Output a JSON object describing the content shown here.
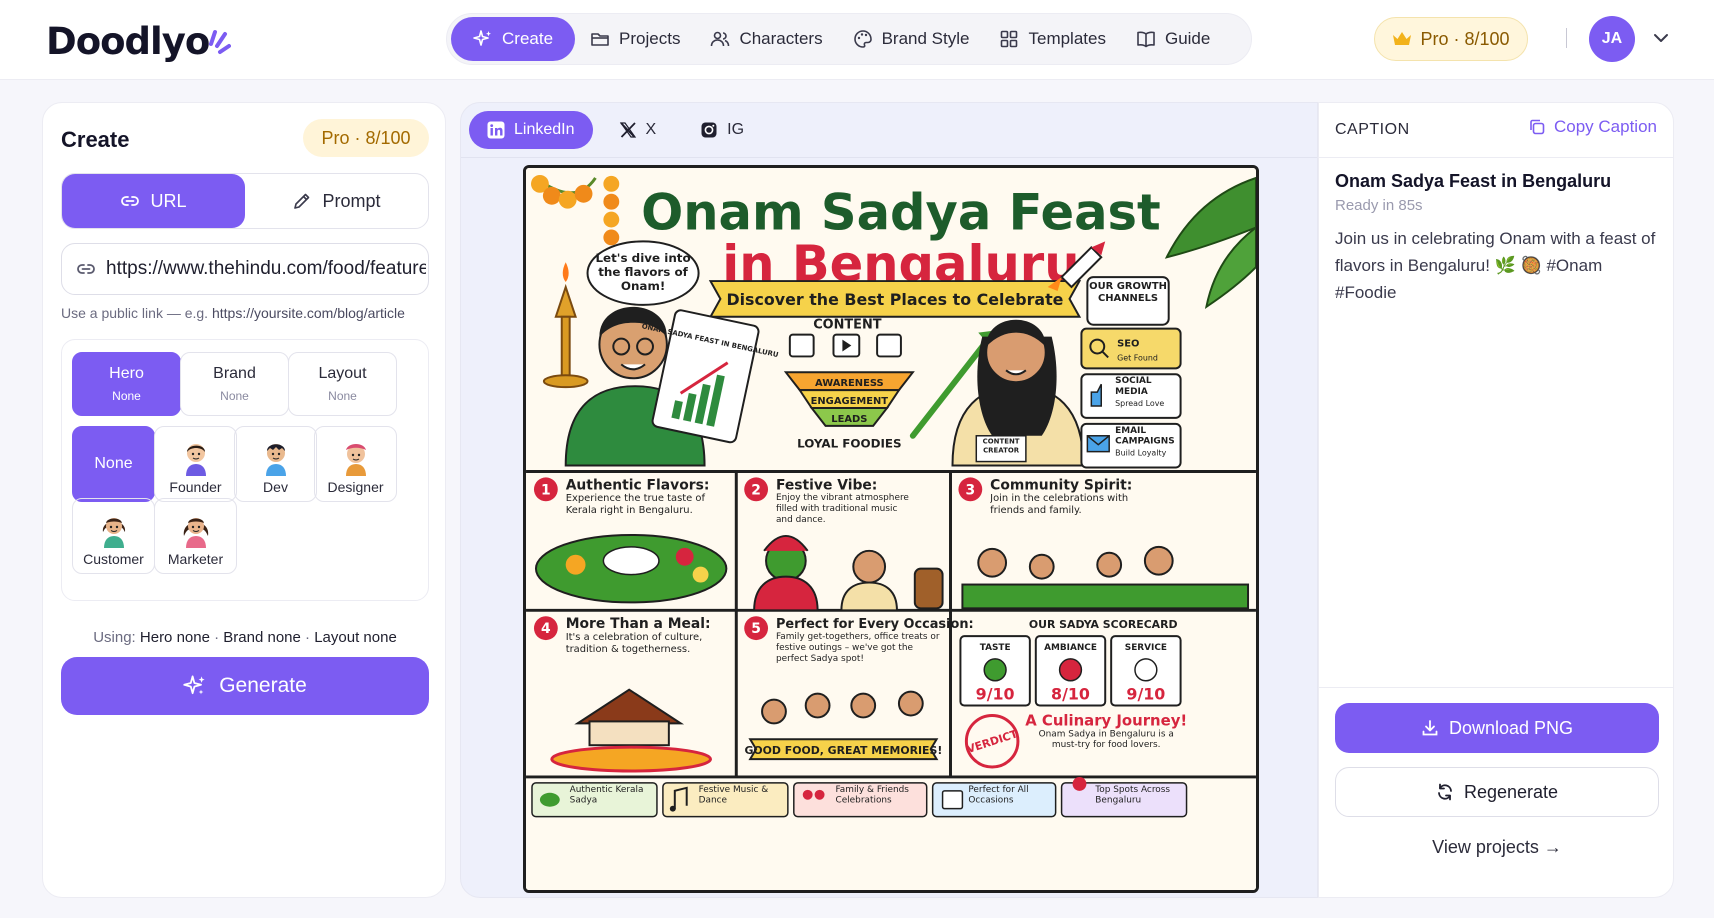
{
  "brand": {
    "logo_text": "Doodlyo",
    "accent": "#7c5cf2"
  },
  "nav": {
    "items": [
      {
        "label": "Create",
        "icon": "sparkle-icon",
        "active": true
      },
      {
        "label": "Projects",
        "icon": "folder-icon"
      },
      {
        "label": "Characters",
        "icon": "users-icon"
      },
      {
        "label": "Brand Style",
        "icon": "palette-icon"
      },
      {
        "label": "Templates",
        "icon": "grid-icon"
      },
      {
        "label": "Guide",
        "icon": "book-icon"
      }
    ],
    "plan": "Pro · 8/100",
    "avatar_initials": "JA"
  },
  "create_panel": {
    "title": "Create",
    "plan": "Pro · 8/100",
    "modes": [
      "URL",
      "Prompt"
    ],
    "active_mode": "URL",
    "url_value": "https://www.thehindu.com/food/features/onam-sadya-bengaluru",
    "url_hint_prefix": "Use a public link — e.g.",
    "url_hint_example": "https://yoursite.com/blog/article",
    "options": [
      {
        "title": "Hero",
        "value": "None",
        "active": true
      },
      {
        "title": "Brand",
        "value": "None"
      },
      {
        "title": "Layout",
        "value": "None"
      }
    ],
    "characters": [
      {
        "label": "None",
        "active": true
      },
      {
        "label": "Founder"
      },
      {
        "label": "Dev"
      },
      {
        "label": "Designer"
      },
      {
        "label": "Customer"
      },
      {
        "label": "Marketer"
      }
    ],
    "using_label": "Using:",
    "using_hero": "Hero none",
    "using_brand": "Brand none",
    "using_layout": "Layout none",
    "generate_label": "Generate"
  },
  "preview": {
    "tabs": [
      {
        "label": "LinkedIn",
        "icon": "linkedin-icon",
        "active": true
      },
      {
        "label": "X",
        "icon": "x-icon"
      },
      {
        "label": "IG",
        "icon": "instagram-icon"
      }
    ],
    "poster": {
      "title_line1": "Onam Sadya Feast",
      "title_line2": "in Bengaluru",
      "subtitle": "Discover the Best Places to Celebrate",
      "speech": "Let's dive into the flavors of Onam!",
      "clipboard": "ONAM SADYA FEAST IN BENGALURU",
      "content_label": "CONTENT",
      "funnel": [
        "AWARENESS",
        "ENGAGEMENT",
        "LEADS"
      ],
      "loyal": "LOYAL FOODIES",
      "creator_tag": "CONTENT CREATOR",
      "channels_title": "OUR GROWTH CHANNELS",
      "channels": [
        {
          "name": "SEO",
          "sub": "Get Found"
        },
        {
          "name": "SOCIAL MEDIA",
          "sub": "Spread Love"
        },
        {
          "name": "EMAIL CAMPAIGNS",
          "sub": "Build Loyalty"
        }
      ],
      "panels": [
        {
          "num": "1",
          "title": "Authentic Flavors:",
          "body": "Experience the true taste of Kerala right in Bengaluru."
        },
        {
          "num": "2",
          "title": "Festive Vibe:",
          "body": "Enjoy the vibrant atmosphere filled with traditional music and dance."
        },
        {
          "num": "3",
          "title": "Community Spirit:",
          "body": "Join in the celebrations with friends and family."
        },
        {
          "num": "4",
          "title": "More Than a Meal:",
          "body": "It's a celebration of culture, tradition & togetherness."
        },
        {
          "num": "5",
          "title": "Perfect for Every Occasion:",
          "body": "Family get-togethers, office treats or festive outings – we've got the perfect Sadya spot!"
        }
      ],
      "memories": "GOOD FOOD, GREAT MEMORIES!",
      "scorecard_title": "OUR SADYA SCORECARD",
      "scores": [
        {
          "label": "TASTE",
          "value": "9/10"
        },
        {
          "label": "AMBIANCE",
          "value": "8/10"
        },
        {
          "label": "SERVICE",
          "value": "9/10"
        }
      ],
      "verdict_stamp": "VERDICT",
      "verdict_title": "A Culinary Journey!",
      "verdict_body": "Onam Sadya in Bengaluru is a must-try for food lovers.",
      "footer": [
        "Authentic Kerala Sadya",
        "Festive Music & Dance",
        "Family & Friends Celebrations",
        "Perfect for All Occasions",
        "Top Spots Across Bengaluru"
      ]
    }
  },
  "caption_panel": {
    "heading": "CAPTION",
    "copy_label": "Copy Caption",
    "title": "Onam Sadya Feast in Bengaluru",
    "status": "Ready in 85s",
    "body": "Join us in celebrating Onam with a feast of flavors in Bengaluru! 🌿 🥘 #Onam #Foodie",
    "download_label": "Download PNG",
    "regenerate_label": "Regenerate",
    "view_projects_label": "View projects →"
  }
}
